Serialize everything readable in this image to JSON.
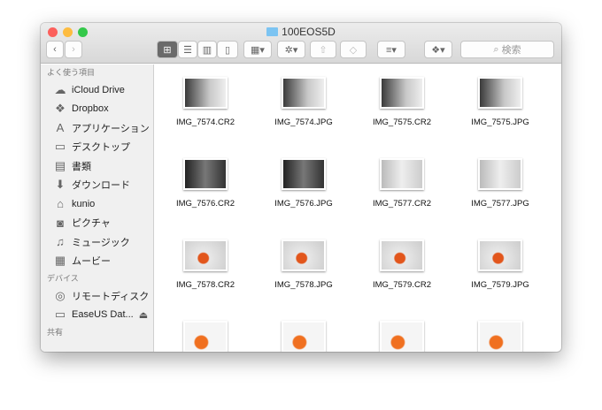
{
  "window": {
    "title": "100EOS5D"
  },
  "toolbar": {
    "search_placeholder": "検索"
  },
  "sidebar": {
    "favorites_label": "よく使う項目",
    "favorites": [
      {
        "label": "iCloud Drive",
        "icon": "cloud-icon"
      },
      {
        "label": "Dropbox",
        "icon": "dropbox-icon"
      },
      {
        "label": "アプリケーション",
        "icon": "applications-icon"
      },
      {
        "label": "デスクトップ",
        "icon": "desktop-icon"
      },
      {
        "label": "書類",
        "icon": "documents-icon"
      },
      {
        "label": "ダウンロード",
        "icon": "download-icon"
      },
      {
        "label": "kunio",
        "icon": "home-icon"
      },
      {
        "label": "ピクチャ",
        "icon": "camera-icon"
      },
      {
        "label": "ミュージック",
        "icon": "music-icon"
      },
      {
        "label": "ムービー",
        "icon": "film-icon"
      }
    ],
    "devices_label": "デバイス",
    "devices": [
      {
        "label": "リモートディスク",
        "icon": "disc-icon"
      },
      {
        "label": "EaseUS Dat...",
        "icon": "drive-icon"
      }
    ],
    "shared_label": "共有"
  },
  "files": [
    {
      "name": "IMG_7574.CR2",
      "tone": "dark"
    },
    {
      "name": "IMG_7574.JPG",
      "tone": "dark"
    },
    {
      "name": "IMG_7575.CR2",
      "tone": "dark"
    },
    {
      "name": "IMG_7575.JPG",
      "tone": "dark"
    },
    {
      "name": "IMG_7576.CR2",
      "tone": "night"
    },
    {
      "name": "IMG_7576.JPG",
      "tone": "night"
    },
    {
      "name": "IMG_7577.CR2",
      "tone": "light"
    },
    {
      "name": "IMG_7577.JPG",
      "tone": "light"
    },
    {
      "name": "IMG_7578.CR2",
      "tone": "orange"
    },
    {
      "name": "IMG_7578.JPG",
      "tone": "orange"
    },
    {
      "name": "IMG_7579.CR2",
      "tone": "orange"
    },
    {
      "name": "IMG_7579.JPG",
      "tone": "orange"
    },
    {
      "name": "",
      "tone": "people"
    },
    {
      "name": "",
      "tone": "people"
    },
    {
      "name": "",
      "tone": "people"
    },
    {
      "name": "",
      "tone": "people"
    }
  ]
}
